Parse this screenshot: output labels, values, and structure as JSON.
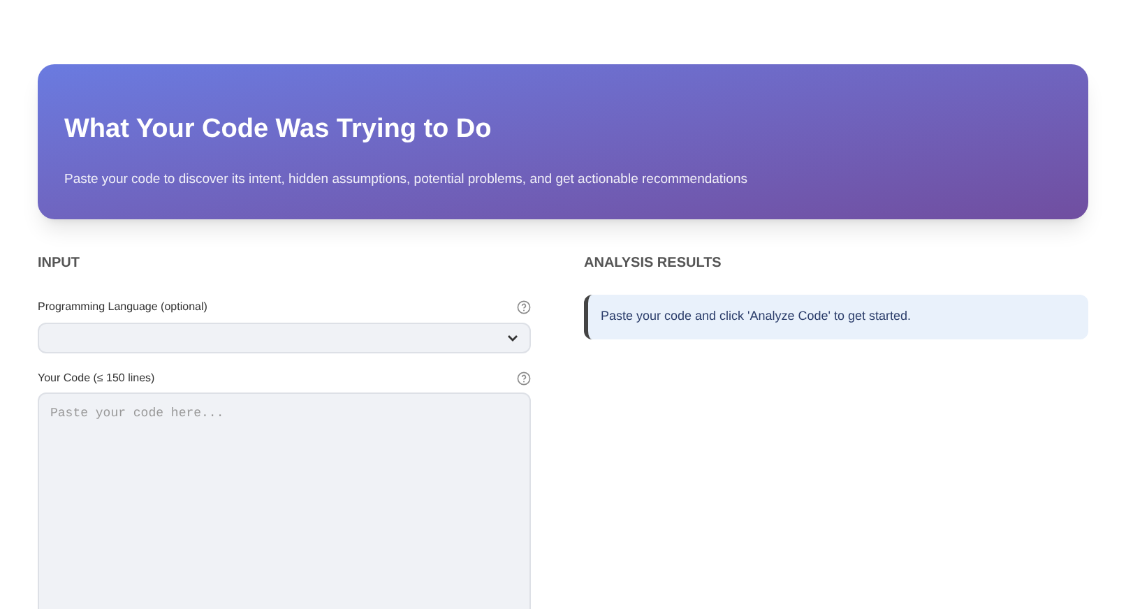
{
  "header": {
    "title": "What Your Code Was Trying to Do",
    "subtitle": "Paste your code to discover its intent, hidden assumptions, potential problems, and get actionable recommendations"
  },
  "input": {
    "heading": "INPUT",
    "language": {
      "label": "Programming Language (optional)"
    },
    "code": {
      "label": "Your Code (≤ 150 lines)",
      "placeholder": "Paste your code here..."
    }
  },
  "results": {
    "heading": "ANALYSIS RESULTS",
    "info": "Paste your code and click 'Analyze Code' to get started."
  }
}
